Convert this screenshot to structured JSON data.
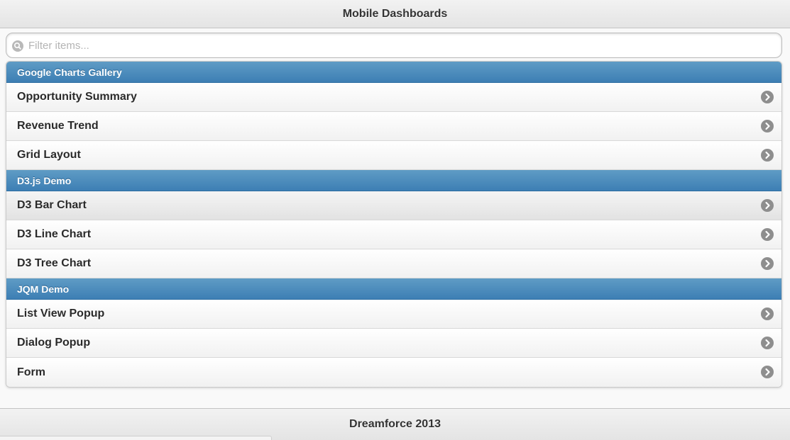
{
  "header": {
    "title": "Mobile Dashboards"
  },
  "filter": {
    "placeholder": "Filter items...",
    "value": ""
  },
  "sections": [
    {
      "title": "Google Charts Gallery",
      "items": [
        {
          "label": "Opportunity Summary"
        },
        {
          "label": "Revenue Trend"
        },
        {
          "label": "Grid Layout"
        }
      ]
    },
    {
      "title": "D3.js Demo",
      "items": [
        {
          "label": "D3 Bar Chart"
        },
        {
          "label": "D3 Line Chart"
        },
        {
          "label": "D3 Tree Chart"
        }
      ]
    },
    {
      "title": "JQM Demo",
      "items": [
        {
          "label": "List View Popup"
        },
        {
          "label": "Dialog Popup"
        },
        {
          "label": "Form"
        }
      ]
    }
  ],
  "footer": {
    "title": "Dreamforce 2013"
  },
  "icons": {
    "filter": "search-icon",
    "item_arrow": "arrow-right-icon"
  },
  "colors": {
    "divider": "#4a8bbf",
    "header_bg": "#ebebeb",
    "chevron": "#8e8e8e"
  }
}
